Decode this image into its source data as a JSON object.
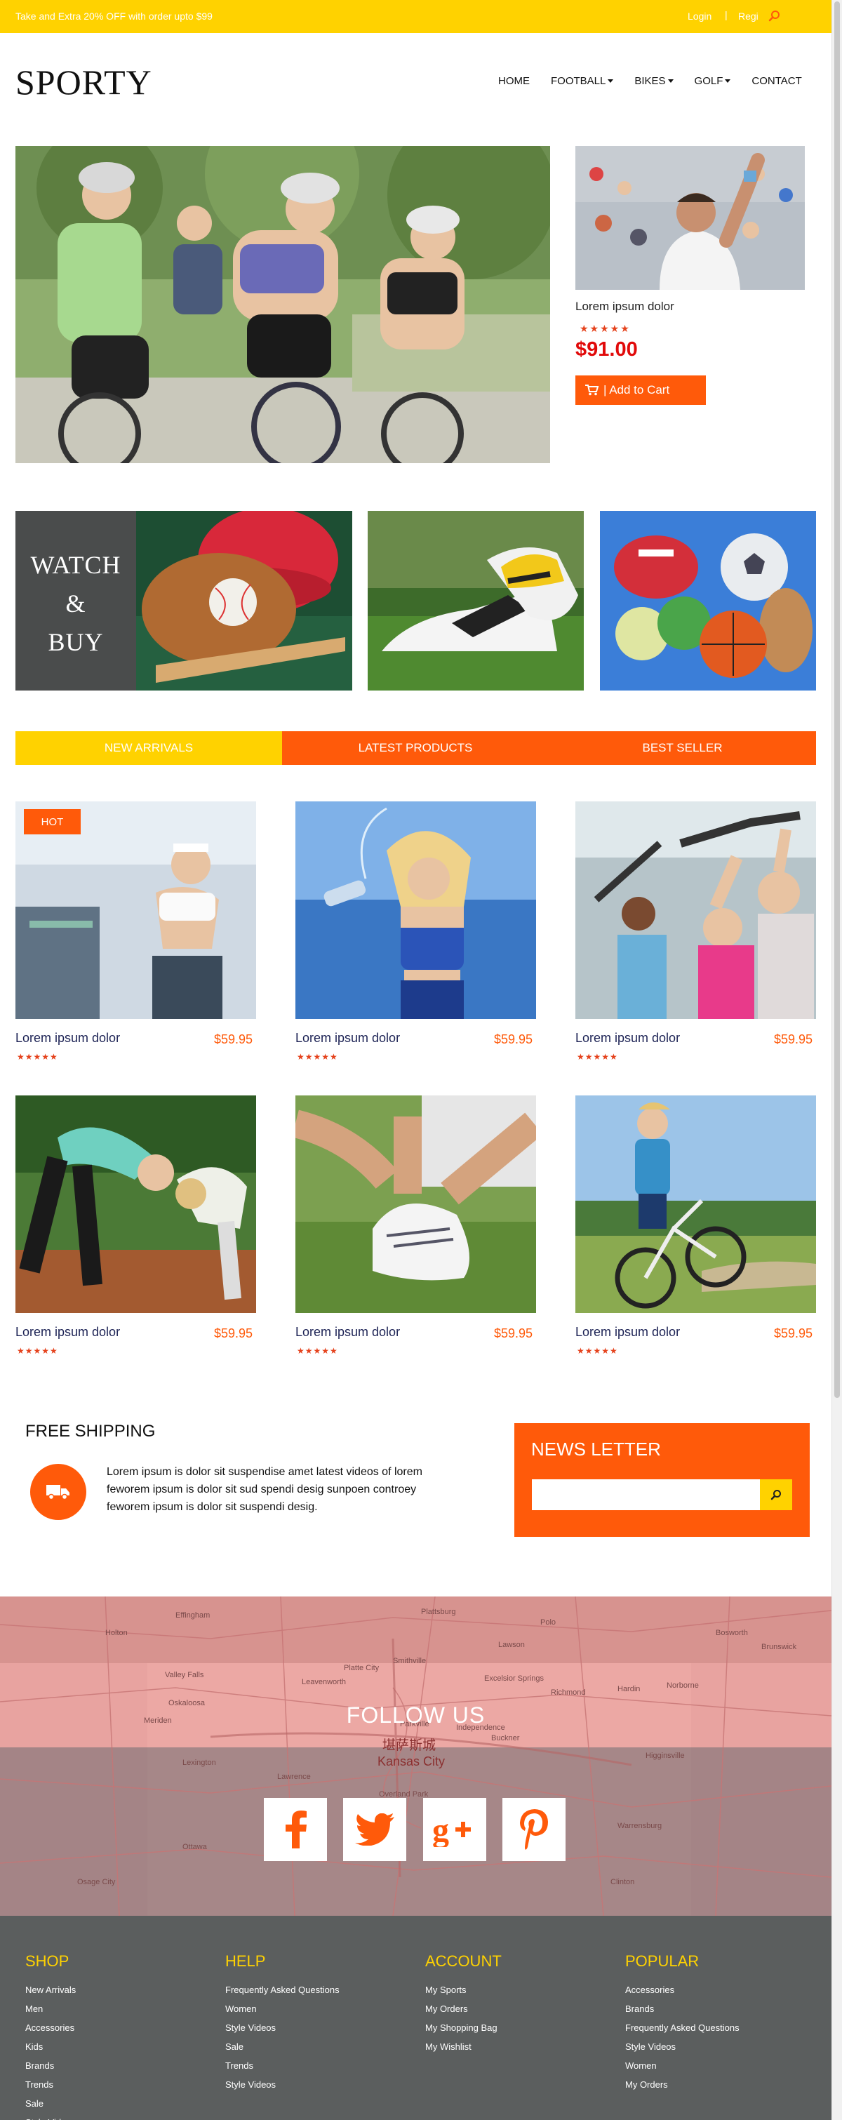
{
  "topbar": {
    "promo": "Take and Extra 20% OFF with order upto $99",
    "login": "Login",
    "separator": "|",
    "register": "Regi",
    "colors": {
      "background": "#ffd200",
      "text": "#ffffff"
    }
  },
  "header": {
    "logo": "SPORTY",
    "nav": [
      {
        "label": "HOME",
        "dropdown": false
      },
      {
        "label": "FOOTBALL",
        "dropdown": true
      },
      {
        "label": "BIKES",
        "dropdown": true
      },
      {
        "label": "GOLF",
        "dropdown": true
      },
      {
        "label": "CONTACT",
        "dropdown": false
      }
    ]
  },
  "hero": {
    "product": {
      "name": "Lorem ipsum dolor",
      "stars": "★★★★★",
      "price": "$91.00",
      "cart_label": "| Add to Cart"
    }
  },
  "promo": {
    "watch_line1": "WATCH",
    "watch_line2": "&",
    "watch_line3": "BUY"
  },
  "tabs": [
    {
      "label": "NEW ARRIVALS",
      "color": "#ffd200"
    },
    {
      "label": "LATEST PRODUCTS",
      "color": "#ff5a0a"
    },
    {
      "label": "BEST SELLER",
      "color": "#ff5a0a"
    }
  ],
  "hot_badge": "HOT",
  "products": [
    {
      "name": "Lorem ipsum dolor",
      "price": "$59.95",
      "stars": "★★★★★"
    },
    {
      "name": "Lorem ipsum dolor",
      "price": "$59.95",
      "stars": "★★★★★"
    },
    {
      "name": "Lorem ipsum dolor",
      "price": "$59.95",
      "stars": "★★★★★"
    },
    {
      "name": "Lorem ipsum dolor",
      "price": "$59.95",
      "stars": "★★★★★"
    },
    {
      "name": "Lorem ipsum dolor",
      "price": "$59.95",
      "stars": "★★★★★"
    },
    {
      "name": "Lorem ipsum dolor",
      "price": "$59.95",
      "stars": "★★★★★"
    }
  ],
  "shipping": {
    "title": "FREE SHIPPING",
    "text": "Lorem ipsum is dolor sit suspendise amet latest videos of lorem feworem ipsum is dolor sit sud spendi desig sunpoen controey feworem ipsum is dolor sit suspendi desig."
  },
  "newsletter": {
    "title": "NEWS LETTER",
    "input_value": "",
    "input_placeholder": ""
  },
  "follow": {
    "title": "FOLLOW US",
    "map_labels": {
      "city": "Kansas City",
      "city_cn": "堪萨斯城",
      "independence": "Independence",
      "leavenworth": "Leavenworth",
      "lawrence": "Lawrence",
      "lexington": "Lexington",
      "richmond": "Richmond",
      "ottawa": "Ottawa",
      "effingham": "Effingham",
      "holton": "Holton",
      "meriden": "Meriden",
      "platte_city": "Platte City",
      "smithville": "Smithville",
      "excelsior": "Excelsior Springs",
      "bosworth": "Bosworth",
      "brunswick": "Brunswick",
      "norborne": "Norborne",
      "hardin": "Hardin",
      "warrensburg": "Warrensburg",
      "clinton": "Clinton",
      "osage_city": "Osage City",
      "overland_park": "Overland Park",
      "parkville": "Parkville",
      "buckner": "Buckner",
      "oskaloosa": "Oskaloosa",
      "plattsburg": "Plattsburg",
      "poio": "Polo",
      "higginsville": "Higginsville",
      "valley_falls": "Valley Falls",
      "lawson": "Lawson"
    },
    "social": [
      {
        "name": "facebook-icon"
      },
      {
        "name": "twitter-icon"
      },
      {
        "name": "google-plus-icon"
      },
      {
        "name": "pinterest-icon"
      }
    ]
  },
  "footer": {
    "columns": [
      {
        "title": "SHOP",
        "links": [
          "New Arrivals",
          "Men",
          "Accessories",
          "Kids",
          "Brands",
          "Trends",
          "Sale",
          "Style Videos"
        ]
      },
      {
        "title": "HELP",
        "links": [
          "Frequently Asked Questions",
          "Women",
          "Style Videos",
          "Sale",
          "Trends",
          "Style Videos"
        ]
      },
      {
        "title": "ACCOUNT",
        "links": [
          "My Sports",
          "My Orders",
          "My Shopping Bag",
          "My Wishlist"
        ]
      },
      {
        "title": "POPULAR",
        "links": [
          "Accessories",
          "Brands",
          "Frequently Asked Questions",
          "Style Videos",
          "Women",
          "My Orders"
        ]
      }
    ]
  },
  "colors": {
    "accent": "#ff5a0a",
    "yellow": "#ffd200",
    "footer_bg": "#5b5e5e",
    "price_red": "#e10a0a"
  }
}
